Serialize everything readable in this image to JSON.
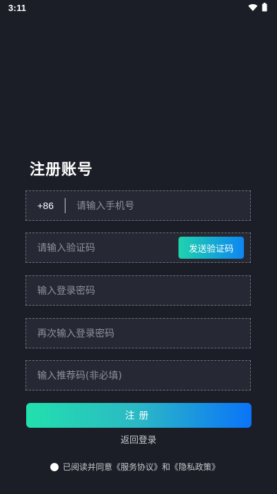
{
  "status_bar": {
    "time": "3:11",
    "icons": [
      "wifi-icon",
      "battery-icon"
    ]
  },
  "title": "注册账号",
  "phone": {
    "country_code": "+86",
    "placeholder": "请输入手机号"
  },
  "code": {
    "placeholder": "请输入验证码",
    "send_button": "发送验证码"
  },
  "password": {
    "placeholder": "输入登录密码"
  },
  "password_confirm": {
    "placeholder": "再次输入登录密码"
  },
  "referral": {
    "placeholder": "输入推荐码(非必填)"
  },
  "register_button": "注册",
  "back_to_login": "返回登录",
  "agreement": {
    "prefix": "已阅读并同意",
    "terms": "《服务协议》",
    "and": "和",
    "privacy": "《隐私政策》"
  },
  "colors": {
    "background": "#1c1e27",
    "field_background": "#262834",
    "gradient_start": "#22e0ad",
    "gradient_end": "#0a74f8"
  }
}
